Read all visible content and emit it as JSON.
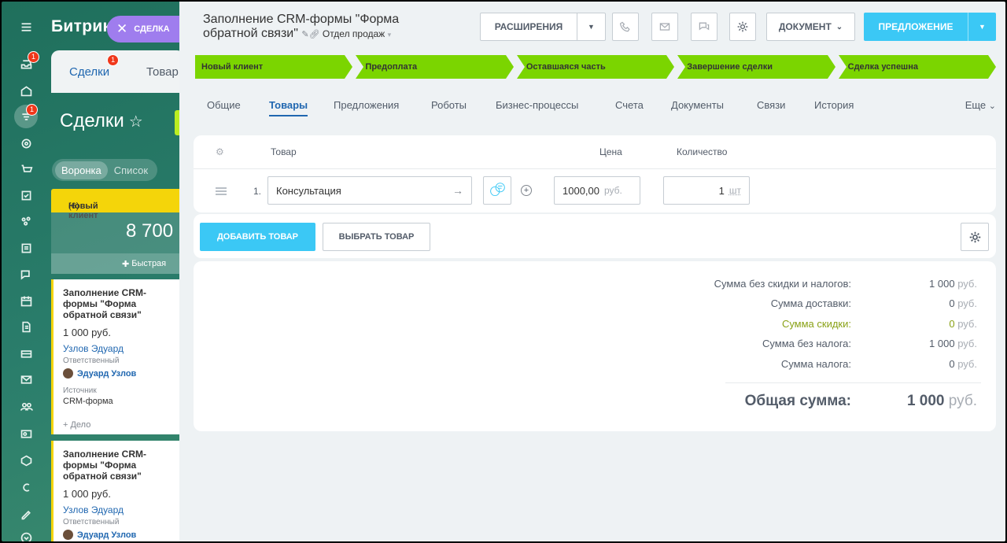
{
  "bg": {
    "logo": "Битрик",
    "deal_pill": "СДЕЛКА",
    "tab_deals": "Сделки",
    "tab_deals_badge": "1",
    "tab_goods": "Товар",
    "title": "Сделки",
    "view_funnel": "Воронка",
    "view_list": "Список",
    "column_title": "Новый клиент",
    "column_count": "(6)",
    "column_sum": "8 700",
    "quick_add": "Быстрая",
    "cards": [
      {
        "title": "Заполнение CRM-формы \"Форма обратной связи\"",
        "price": "1 000 руб.",
        "link": "Узлов Эдуард",
        "resp_label": "Ответственный",
        "user": "Эдуард Узлов",
        "src_label": "Источник",
        "src_value": "CRM-форма",
        "add": "+ Дело"
      },
      {
        "title": "Заполнение CRM-формы \"Форма обратной связи\"",
        "price": "1 000 руб.",
        "link": "Узлов Эдуард",
        "resp_label": "Ответственный",
        "user": "Эдуард Узлов"
      }
    ],
    "badges": {
      "inbox": "1",
      "filter": "1"
    }
  },
  "header": {
    "title_line1": "Заполнение CRM-формы \"Форма",
    "title_line2": "обратной связи\"",
    "department": "Отдел продаж",
    "extensions_label": "РАСШИРЕНИЯ",
    "document_label": "ДОКУМЕНТ",
    "proposal_label": "ПРЕДЛОЖЕНИЕ"
  },
  "stages": [
    "Новый клиент",
    "Предоплата",
    "Оставшаяся часть",
    "Завершение сделки",
    "Сделка успешна"
  ],
  "tabs": [
    "Общие",
    "Товары",
    "Предложения",
    "Роботы",
    "Бизнес-процессы",
    "Счета",
    "Документы",
    "Связи",
    "История"
  ],
  "tabs_more": "Еще",
  "products": {
    "col_product": "Товар",
    "col_price": "Цена",
    "col_qty": "Количество",
    "rows": [
      {
        "num": "1.",
        "name": "Консультация",
        "price": "1000,00",
        "currency": "руб.",
        "qty": "1",
        "unit": "шт"
      }
    ],
    "add_button": "ДОБАВИТЬ ТОВАР",
    "pick_button": "ВЫБРАТЬ ТОВАР"
  },
  "totals": {
    "rows": [
      {
        "label": "Сумма без скидки и налогов:",
        "value": "1 000",
        "currency": "руб."
      },
      {
        "label": "Сумма доставки:",
        "value": "0",
        "currency": "руб."
      },
      {
        "label": "Сумма скидки:",
        "value": "0",
        "currency": "руб."
      },
      {
        "label": "Сумма без налога:",
        "value": "1 000",
        "currency": "руб."
      },
      {
        "label": "Сумма налога:",
        "value": "0",
        "currency": "руб."
      }
    ],
    "total_label": "Общая сумма:",
    "total_value": "1 000",
    "total_currency": "руб."
  },
  "colors": {
    "stage_green": "#7bd500",
    "accent_blue": "#3bc8f5",
    "discount": "#8aa217"
  }
}
